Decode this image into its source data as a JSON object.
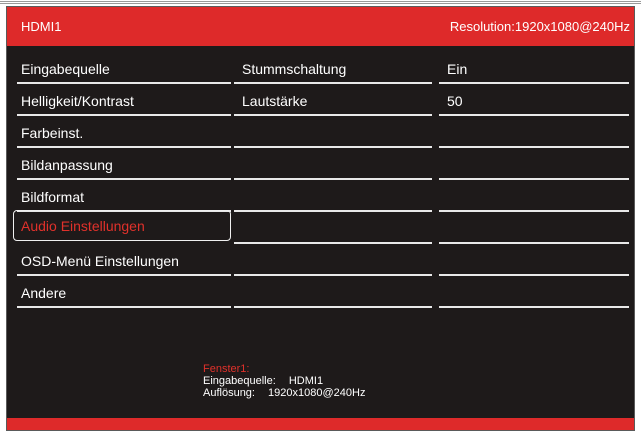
{
  "header": {
    "source": "HDMI1",
    "resolution": "Resolution:1920x1080@240Hz"
  },
  "menu": {
    "items": [
      {
        "label": "Eingabequelle"
      },
      {
        "label": "Helligkeit/Kontrast"
      },
      {
        "label": "Farbeinst."
      },
      {
        "label": "Bildanpassung"
      },
      {
        "label": "Bildformat"
      },
      {
        "label": "Audio Einstellungen",
        "selected": true
      },
      {
        "label": "OSD-Menü Einstellungen"
      },
      {
        "label": "Andere"
      }
    ]
  },
  "submenu": {
    "rows": [
      {
        "name": "Stummschaltung",
        "value": "Ein"
      },
      {
        "name": "Lautstärke",
        "value": "50"
      },
      {
        "name": "",
        "value": ""
      },
      {
        "name": "",
        "value": ""
      },
      {
        "name": "",
        "value": ""
      },
      {
        "name": "",
        "value": ""
      },
      {
        "name": "",
        "value": ""
      },
      {
        "name": "",
        "value": ""
      }
    ]
  },
  "info": {
    "title": "Fenster1:",
    "input_label": "Eingabequelle:",
    "input_value": "HDMI1",
    "resolution_label": "Auflösung:",
    "resolution_value": "1920x1080@240Hz"
  },
  "colors": {
    "accent": "#de2a2a",
    "background": "#1e1a1a",
    "selected_text": "#e0312b"
  }
}
